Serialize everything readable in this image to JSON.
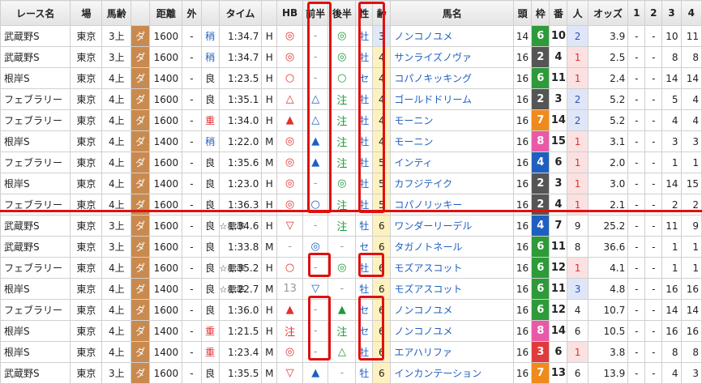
{
  "headers": [
    "レース名",
    "場",
    "馬齢",
    "",
    "距離",
    "外",
    "",
    "タイム",
    "",
    "HB",
    "前半",
    "後半",
    "性",
    "齢",
    "馬名",
    "頭",
    "枠",
    "番",
    "人",
    "オッズ",
    "1",
    "2",
    "3",
    "4"
  ],
  "rows": [
    {
      "race": "武蔵野S",
      "place": "東京",
      "cls": "3上",
      "surface": "ダ",
      "dist": "1600",
      "out": "-",
      "cond": "稍",
      "cond_color": "blue",
      "note": "",
      "time": "1:34.7",
      "pace": "H",
      "hb": "◎",
      "hb_c": "red",
      "first": "-",
      "first_c": "gray",
      "second": "◎",
      "second_c": "green",
      "sex": "牡",
      "age": "3",
      "name": "ノンコノユメ",
      "heads": "14",
      "waku": "6",
      "waku_bg": "#2e9a3a",
      "ban": "10",
      "pop": "2",
      "pop_c": "pop2",
      "odds": "3.9",
      "p1": "-",
      "p2": "-",
      "p3": "10",
      "p4": "11"
    },
    {
      "race": "武蔵野S",
      "place": "東京",
      "cls": "3上",
      "surface": "ダ",
      "dist": "1600",
      "out": "-",
      "cond": "稍",
      "cond_color": "blue",
      "note": "",
      "time": "1:34.7",
      "pace": "H",
      "hb": "◎",
      "hb_c": "red",
      "first": "-",
      "first_c": "gray",
      "second": "◎",
      "second_c": "green",
      "sex": "牡",
      "age": "4",
      "name": "サンライズノヴァ",
      "heads": "16",
      "waku": "2",
      "waku_bg": "#555555",
      "ban": "4",
      "pop": "1",
      "pop_c": "pop1",
      "odds": "2.5",
      "p1": "-",
      "p2": "-",
      "p3": "8",
      "p4": "8"
    },
    {
      "race": "根岸S",
      "place": "東京",
      "cls": "4上",
      "surface": "ダ",
      "dist": "1400",
      "out": "-",
      "cond": "良",
      "cond_color": "",
      "note": "",
      "time": "1:23.5",
      "pace": "H",
      "hb": "○",
      "hb_c": "red",
      "first": "-",
      "first_c": "gray",
      "second": "○",
      "second_c": "green",
      "sex": "セ",
      "age": "4",
      "name": "コパノキッキング",
      "heads": "16",
      "waku": "6",
      "waku_bg": "#2e9a3a",
      "ban": "11",
      "pop": "1",
      "pop_c": "pop1",
      "odds": "2.4",
      "p1": "-",
      "p2": "-",
      "p3": "14",
      "p4": "14"
    },
    {
      "race": "フェブラリー",
      "place": "東京",
      "cls": "4上",
      "surface": "ダ",
      "dist": "1600",
      "out": "-",
      "cond": "良",
      "cond_color": "",
      "note": "",
      "time": "1:35.1",
      "pace": "H",
      "hb": "△",
      "hb_c": "red",
      "first": "△",
      "first_c": "blue",
      "second": "注",
      "second_c": "green",
      "sex": "牡",
      "age": "4",
      "name": "ゴールドドリーム",
      "heads": "16",
      "waku": "2",
      "waku_bg": "#555555",
      "ban": "3",
      "pop": "2",
      "pop_c": "pop2",
      "odds": "5.2",
      "p1": "-",
      "p2": "-",
      "p3": "5",
      "p4": "4"
    },
    {
      "race": "フェブラリー",
      "place": "東京",
      "cls": "4上",
      "surface": "ダ",
      "dist": "1600",
      "out": "-",
      "cond": "重",
      "cond_color": "red",
      "note": "",
      "time": "1:34.0",
      "pace": "H",
      "hb": "▲",
      "hb_c": "red",
      "first": "△",
      "first_c": "blue",
      "second": "注",
      "second_c": "green",
      "sex": "牡",
      "age": "4",
      "name": "モーニン",
      "heads": "16",
      "waku": "7",
      "waku_bg": "#f08a1c",
      "ban": "14",
      "pop": "2",
      "pop_c": "pop2",
      "odds": "5.2",
      "p1": "-",
      "p2": "-",
      "p3": "4",
      "p4": "4"
    },
    {
      "race": "根岸S",
      "place": "東京",
      "cls": "4上",
      "surface": "ダ",
      "dist": "1400",
      "out": "-",
      "cond": "稍",
      "cond_color": "blue",
      "note": "",
      "time": "1:22.0",
      "pace": "M",
      "hb": "◎",
      "hb_c": "red",
      "first": "▲",
      "first_c": "blue",
      "second": "注",
      "second_c": "green",
      "sex": "牡",
      "age": "4",
      "name": "モーニン",
      "heads": "16",
      "waku": "8",
      "waku_bg": "#e85aa8",
      "ban": "15",
      "pop": "1",
      "pop_c": "pop1",
      "odds": "3.1",
      "p1": "-",
      "p2": "-",
      "p3": "3",
      "p4": "3"
    },
    {
      "race": "フェブラリー",
      "place": "東京",
      "cls": "4上",
      "surface": "ダ",
      "dist": "1600",
      "out": "-",
      "cond": "良",
      "cond_color": "",
      "note": "",
      "time": "1:35.6",
      "pace": "M",
      "hb": "◎",
      "hb_c": "red",
      "first": "▲",
      "first_c": "blue",
      "second": "注",
      "second_c": "green",
      "sex": "牡",
      "age": "5",
      "name": "インティ",
      "heads": "16",
      "waku": "4",
      "waku_bg": "#1f5fbf",
      "ban": "6",
      "pop": "1",
      "pop_c": "pop1",
      "odds": "2.0",
      "p1": "-",
      "p2": "-",
      "p3": "1",
      "p4": "1"
    },
    {
      "race": "根岸S",
      "place": "東京",
      "cls": "4上",
      "surface": "ダ",
      "dist": "1400",
      "out": "-",
      "cond": "良",
      "cond_color": "",
      "note": "",
      "time": "1:23.0",
      "pace": "H",
      "hb": "◎",
      "hb_c": "red",
      "first": "-",
      "first_c": "gray",
      "second": "◎",
      "second_c": "green",
      "sex": "牡",
      "age": "5",
      "name": "カフジテイク",
      "heads": "16",
      "waku": "2",
      "waku_bg": "#555555",
      "ban": "3",
      "pop": "1",
      "pop_c": "pop1",
      "odds": "3.0",
      "p1": "-",
      "p2": "-",
      "p3": "14",
      "p4": "15"
    },
    {
      "race": "フェブラリー",
      "place": "東京",
      "cls": "4上",
      "surface": "ダ",
      "dist": "1600",
      "out": "-",
      "cond": "良",
      "cond_color": "",
      "note": "",
      "time": "1:36.3",
      "pace": "H",
      "hb": "◎",
      "hb_c": "red",
      "first": "○",
      "first_c": "blue",
      "second": "注",
      "second_c": "green",
      "sex": "牡",
      "age": "5",
      "name": "コパノリッキー",
      "heads": "16",
      "waku": "2",
      "waku_bg": "#555555",
      "ban": "4",
      "pop": "1",
      "pop_c": "pop1",
      "odds": "2.1",
      "p1": "-",
      "p2": "-",
      "p3": "2",
      "p4": "2"
    },
    {
      "race": "武蔵野S",
      "place": "東京",
      "cls": "3上",
      "surface": "ダ",
      "dist": "1600",
      "out": "-",
      "cond": "良",
      "cond_color": "",
      "note": "☆標準",
      "time": "1:34.6",
      "pace": "H",
      "hb": "▽",
      "hb_c": "red",
      "first": "-",
      "first_c": "gray",
      "second": "注",
      "second_c": "green",
      "sex": "牡",
      "age": "6",
      "name": "ワンダーリーデル",
      "heads": "16",
      "waku": "4",
      "waku_bg": "#1f5fbf",
      "ban": "7",
      "pop": "9",
      "pop_c": "pop",
      "odds": "25.2",
      "p1": "-",
      "p2": "-",
      "p3": "11",
      "p4": "9"
    },
    {
      "race": "武蔵野S",
      "place": "東京",
      "cls": "3上",
      "surface": "ダ",
      "dist": "1600",
      "out": "-",
      "cond": "良",
      "cond_color": "",
      "note": "",
      "time": "1:33.8",
      "pace": "M",
      "hb": "-",
      "hb_c": "gray",
      "first": "◎",
      "first_c": "blue",
      "second": "-",
      "second_c": "gray",
      "sex": "セ",
      "age": "6",
      "name": "タガノトネール",
      "heads": "16",
      "waku": "6",
      "waku_bg": "#2e9a3a",
      "ban": "11",
      "pop": "8",
      "pop_c": "pop",
      "odds": "36.6",
      "p1": "-",
      "p2": "-",
      "p3": "1",
      "p4": "1"
    },
    {
      "race": "フェブラリー",
      "place": "東京",
      "cls": "4上",
      "surface": "ダ",
      "dist": "1600",
      "out": "-",
      "cond": "良",
      "cond_color": "",
      "note": "☆標準",
      "time": "1:35.2",
      "pace": "H",
      "hb": "○",
      "hb_c": "red",
      "first": "-",
      "first_c": "gray",
      "second": "◎",
      "second_c": "green",
      "sex": "牡",
      "age": "6",
      "name": "モズアスコット",
      "heads": "16",
      "waku": "6",
      "waku_bg": "#2e9a3a",
      "ban": "12",
      "pop": "1",
      "pop_c": "pop1",
      "odds": "4.1",
      "p1": "-",
      "p2": "-",
      "p3": "1",
      "p4": "1"
    },
    {
      "race": "根岸S",
      "place": "東京",
      "cls": "4上",
      "surface": "ダ",
      "dist": "1400",
      "out": "-",
      "cond": "良",
      "cond_color": "",
      "note": "☆標準",
      "time": "1:22.7",
      "pace": "M",
      "hb": "13",
      "hb_c": "gray",
      "first": "▽",
      "first_c": "blue",
      "second": "-",
      "second_c": "gray",
      "sex": "牡",
      "age": "6",
      "name": "モズアスコット",
      "heads": "16",
      "waku": "6",
      "waku_bg": "#2e9a3a",
      "ban": "11",
      "pop": "3",
      "pop_c": "pop3",
      "odds": "4.8",
      "p1": "-",
      "p2": "-",
      "p3": "16",
      "p4": "16"
    },
    {
      "race": "フェブラリー",
      "place": "東京",
      "cls": "4上",
      "surface": "ダ",
      "dist": "1600",
      "out": "-",
      "cond": "良",
      "cond_color": "",
      "note": "",
      "time": "1:36.0",
      "pace": "H",
      "hb": "▲",
      "hb_c": "red",
      "first": "-",
      "first_c": "gray",
      "second": "▲",
      "second_c": "green",
      "sex": "セ",
      "age": "6",
      "name": "ノンコノユメ",
      "heads": "16",
      "waku": "6",
      "waku_bg": "#2e9a3a",
      "ban": "12",
      "pop": "4",
      "pop_c": "pop",
      "odds": "10.7",
      "p1": "-",
      "p2": "-",
      "p3": "14",
      "p4": "14"
    },
    {
      "race": "根岸S",
      "place": "東京",
      "cls": "4上",
      "surface": "ダ",
      "dist": "1400",
      "out": "-",
      "cond": "重",
      "cond_color": "red",
      "note": "",
      "time": "1:21.5",
      "pace": "H",
      "hb": "注",
      "hb_c": "red",
      "first": "-",
      "first_c": "gray",
      "second": "注",
      "second_c": "green",
      "sex": "セ",
      "age": "6",
      "name": "ノンコノユメ",
      "heads": "16",
      "waku": "8",
      "waku_bg": "#e85aa8",
      "ban": "14",
      "pop": "6",
      "pop_c": "pop",
      "odds": "10.5",
      "p1": "-",
      "p2": "-",
      "p3": "16",
      "p4": "16"
    },
    {
      "race": "根岸S",
      "place": "東京",
      "cls": "4上",
      "surface": "ダ",
      "dist": "1400",
      "out": "-",
      "cond": "重",
      "cond_color": "red",
      "note": "",
      "time": "1:23.4",
      "pace": "M",
      "hb": "◎",
      "hb_c": "red",
      "first": "-",
      "first_c": "gray",
      "second": "△",
      "second_c": "green",
      "sex": "牡",
      "age": "6",
      "name": "エアハリファ",
      "heads": "16",
      "waku": "3",
      "waku_bg": "#e03a3a",
      "ban": "6",
      "pop": "1",
      "pop_c": "pop1",
      "odds": "3.8",
      "p1": "-",
      "p2": "-",
      "p3": "8",
      "p4": "8"
    },
    {
      "race": "武蔵野S",
      "place": "東京",
      "cls": "3上",
      "surface": "ダ",
      "dist": "1600",
      "out": "-",
      "cond": "良",
      "cond_color": "",
      "note": "",
      "time": "1:35.5",
      "pace": "M",
      "hb": "▽",
      "hb_c": "red",
      "first": "▲",
      "first_c": "blue",
      "second": "-",
      "second_c": "gray",
      "sex": "牡",
      "age": "6",
      "name": "インカンテーション",
      "heads": "16",
      "waku": "7",
      "waku_bg": "#f08a1c",
      "ban": "13",
      "pop": "6",
      "pop_c": "pop",
      "odds": "13.9",
      "p1": "-",
      "p2": "-",
      "p3": "4",
      "p4": "3"
    }
  ]
}
